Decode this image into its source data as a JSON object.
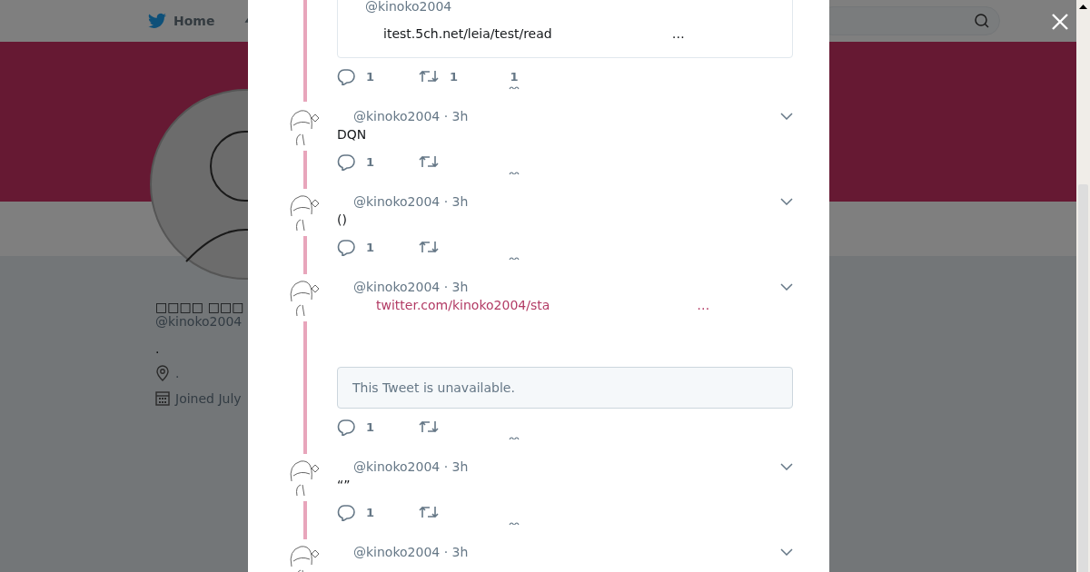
{
  "page": {
    "nav": {
      "home_label": "Home"
    },
    "profile": {
      "name": "□□□□ □□□",
      "handle": "@kinoko2004",
      "bio": ".",
      "location": ".",
      "joined": "Joined July"
    }
  },
  "modal": {
    "quoted_card": {
      "handle": "@kinoko2004",
      "link": "itest.5ch.net/leia/test/read",
      "ellipsis": "…"
    },
    "first_actions": {
      "replies": "1",
      "retweets": "1",
      "likes": "1"
    },
    "tweets": [
      {
        "kind": "text",
        "handle": "@kinoko2004",
        "separator": "·",
        "time": "3h",
        "text": "DQN",
        "actions": {
          "replies": "1"
        }
      },
      {
        "kind": "text",
        "handle": "@kinoko2004",
        "separator": "·",
        "time": "3h",
        "text": "()",
        "actions": {
          "replies": "1"
        }
      },
      {
        "kind": "link",
        "handle": "@kinoko2004",
        "separator": "·",
        "time": "3h",
        "link": "twitter.com/kinoko2004/sta",
        "ellipsis": "…",
        "unavailable": "This Tweet is unavailable.",
        "actions": {
          "replies": "1"
        }
      },
      {
        "kind": "text",
        "handle": "@kinoko2004",
        "separator": "·",
        "time": "3h",
        "text": "“”",
        "actions": {
          "replies": "1"
        }
      },
      {
        "kind": "header",
        "handle": "@kinoko2004",
        "separator": "·",
        "time": "3h"
      }
    ]
  }
}
